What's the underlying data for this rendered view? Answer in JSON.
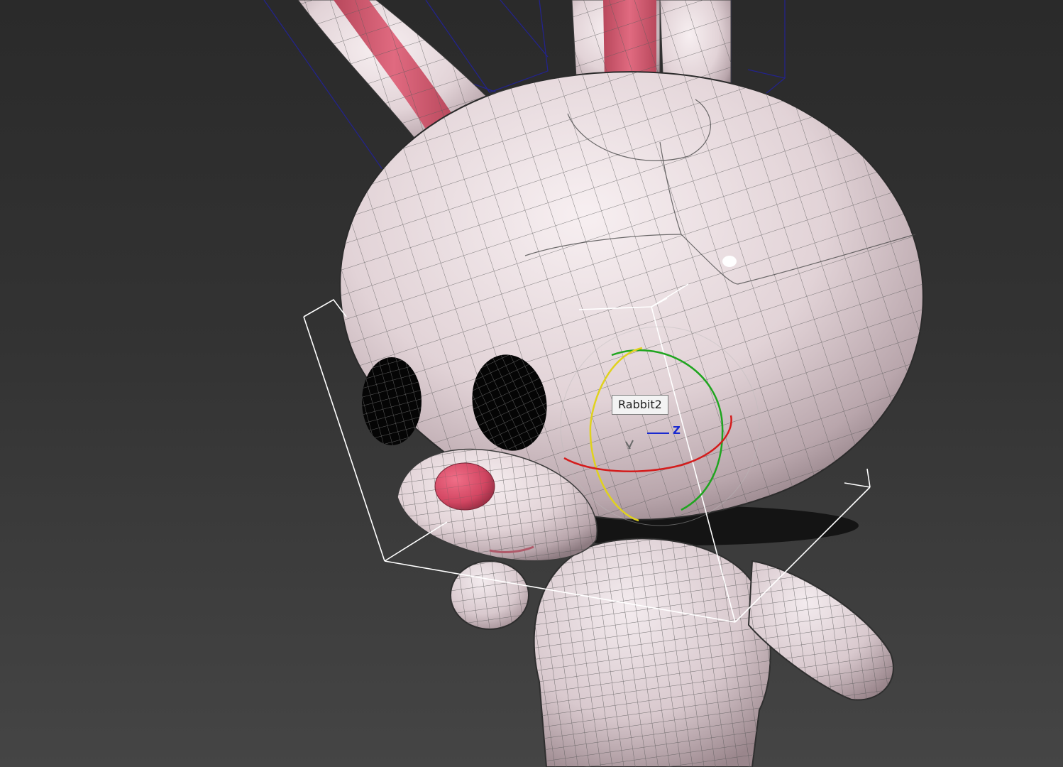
{
  "viewport": {
    "background_top": "#2a2a2a",
    "background_bottom": "#454545"
  },
  "selected_object": {
    "name_tooltip": "Rabbit2"
  },
  "gizmo": {
    "type": "rotate",
    "axis_label": "Z",
    "colors": {
      "x_ring": "#d41c1c",
      "y_ring": "#1fa51f",
      "z_ring": "#e0d21e",
      "z_axis": "#1a2ad0"
    }
  },
  "model": {
    "name": "rabbit",
    "skin_color": "#e9dde0",
    "accent_color": "#d24e66",
    "wire_color": "#555555"
  }
}
